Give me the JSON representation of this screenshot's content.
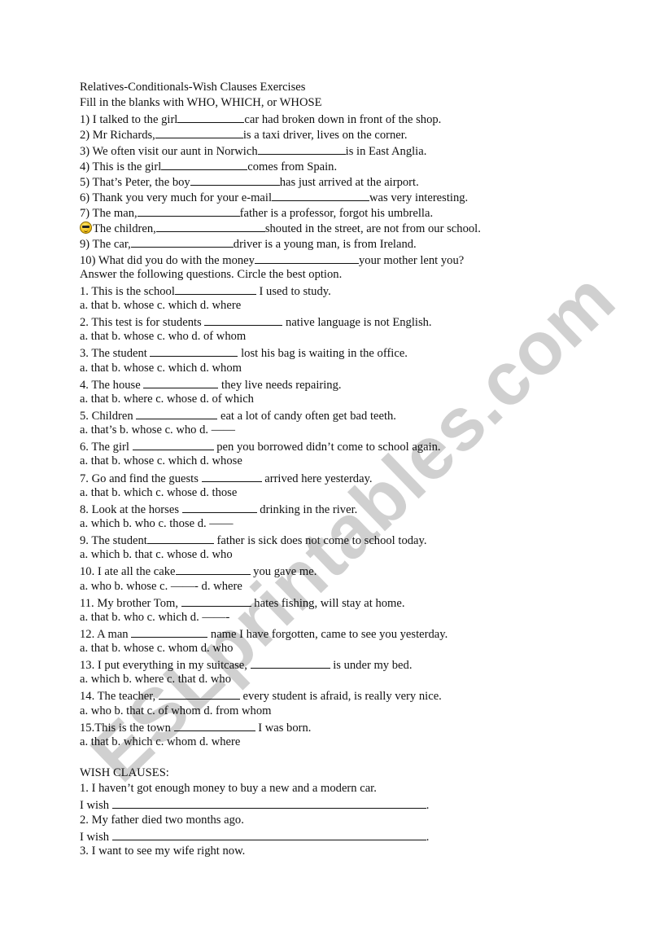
{
  "watermark": "ESLprintables.com",
  "title": "Relatives-Conditionals-Wish Clauses Exercises",
  "section1": {
    "instruction": "Fill in the blanks with WHO, WHICH, or WHOSE",
    "items": [
      {
        "before": "1) I talked to the girl",
        "after": "car had broken down in front of the shop."
      },
      {
        "before": "2) Mr Richards,",
        "after": "is a taxi driver, lives on the corner."
      },
      {
        "before": "3) We often visit our aunt in Norwich",
        "after": "is in East Anglia."
      },
      {
        "before": "4) This is the girl",
        "after": "comes from Spain."
      },
      {
        "before": "5) That’s Peter, the boy",
        "after": "has just arrived at the airport."
      },
      {
        "before": "6) Thank you very much for your e-mail",
        "after": "was very interesting."
      },
      {
        "before": "7) The man,",
        "after": "father is a professor, forgot his umbrella."
      },
      {
        "icon": "sunglasses-smiley-icon",
        "before": "The children,",
        "after": "shouted in the street, are not from our school."
      },
      {
        "before": "9) The car,",
        "after": "driver is a young man, is from Ireland."
      },
      {
        "before": "10) What did you do with the money",
        "after": "your mother lent you?"
      }
    ]
  },
  "section2": {
    "instruction": "Answer the following questions. Circle the best option.",
    "items": [
      {
        "before": "1. This is the school",
        "after": " I used to study.",
        "options": "a. that b.  whose c. which d.  where"
      },
      {
        "before": "2. This test is for students ",
        "after": " native language is not English.",
        "options": "a. that b.  whose c. who d.  of whom"
      },
      {
        "before": "3. The student ",
        "after": " lost his bag is waiting in the office.",
        "options": "a. that b.  whose c. which d.  whom"
      },
      {
        "before": "4. The house ",
        "after": " they live needs repairing.",
        "options": "a. that b.  where c. whose d.  of which"
      },
      {
        "before": "5. Children ",
        "after": " eat a lot of candy often get bad teeth.",
        "options": "a. that’s b.  whose c. who d. ——"
      },
      {
        "before": "6. The girl ",
        "after": " pen you borrowed didn’t come to school again.",
        "options": "a. that b.  whose c. which d.  whose"
      },
      {
        "before": "7. Go and find the guests ",
        "after": " arrived here yesterday.",
        "options": "a. that b.  which c. whose d. those"
      },
      {
        "before": "8. Look at the horses ",
        "after": " drinking in the river.",
        "options": "a. which b.  who c. those d. ——"
      },
      {
        "before": "9. The student",
        "after": " father is sick does not come to school today.",
        "options": "a. which b. that c. whose d. who"
      },
      {
        "before": "10. I ate all the cake",
        "after": " you gave me.",
        "options": "a. who b.  whose c. ——- d. where"
      },
      {
        "before": "11. My brother Tom, ",
        "after": " hates fishing, will stay at home.",
        "options": "a. that b.  who c. which d. ——-"
      },
      {
        "before": "12. A man ",
        "after": " name I have forgotten, came to see you yesterday.",
        "options": "a. that b.  whose c. whom d.  who"
      },
      {
        "before": "13. I put everything in my suitcase, ",
        "after": " is under my bed.",
        "options": "a. which b. where c. that d. who"
      },
      {
        "before": "14. The teacher, ",
        "after": " every student is afraid, is really very nice.",
        "options": "a. who b. that c. of whom d. from whom"
      },
      {
        "before": "15.This is the town ",
        "after": " I was born.",
        "options": "a. that b.  which c. whom d.  where"
      }
    ]
  },
  "section3": {
    "heading": "WISH CLAUSES:",
    "items": [
      {
        "sentence": "1. I haven’t got enough money to buy a new and a modern car.",
        "prompt": "I wish ",
        "end": "."
      },
      {
        "sentence": "2. My father died two months ago.",
        "prompt": "I wish ",
        "end": "."
      },
      {
        "sentence": "3. I want to see my wife right now."
      }
    ]
  }
}
